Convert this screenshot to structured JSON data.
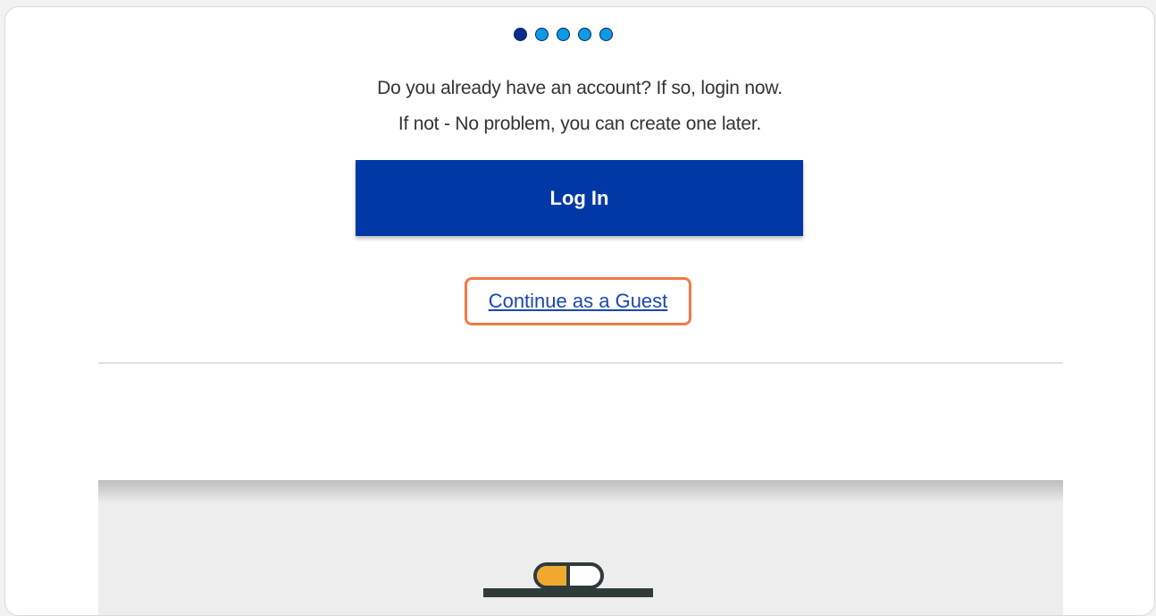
{
  "progress": {
    "total_steps": 5,
    "current_step": 1,
    "active_color": "#0a2d8c",
    "inactive_color": "#0d9be6"
  },
  "prompt": {
    "line1": "Do you already have an account? If so, login now.",
    "line2": "If not - No problem, you can create one later."
  },
  "actions": {
    "login_label": "Log In",
    "guest_label": "Continue as a Guest"
  },
  "colors": {
    "brand_blue": "#0039a6",
    "link_blue": "#1a47b0",
    "highlight_orange": "#f07a46"
  },
  "illustration": {
    "icon": "pill-capsule-icon"
  }
}
